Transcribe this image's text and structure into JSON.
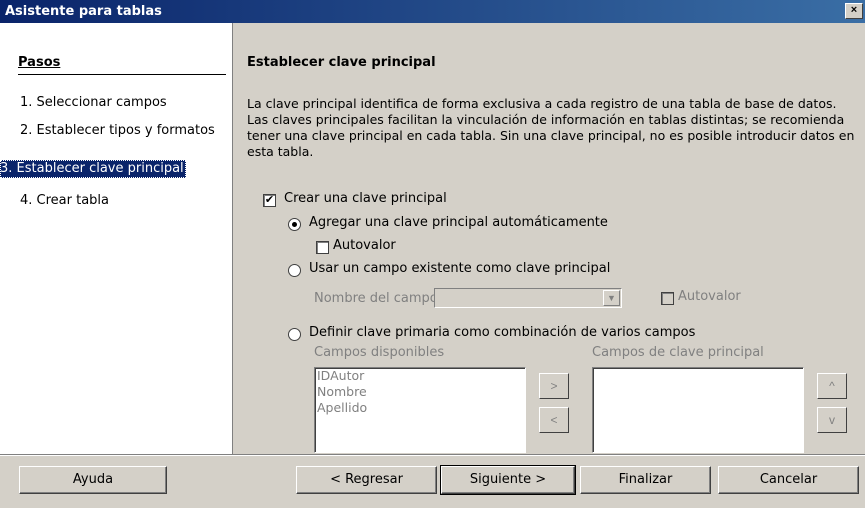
{
  "window": {
    "title": "Asistente para tablas",
    "close_glyph": "×"
  },
  "steps": {
    "header": "Pasos",
    "items": [
      "1.  Seleccionar campos",
      "2.  Establecer tipos y formatos",
      "3.  Establecer clave principal",
      "4.  Crear tabla"
    ],
    "selected_index": 2
  },
  "page": {
    "title": "Establecer clave principal",
    "description": "La clave principal identifica de forma exclusiva a cada registro de una tabla de base de datos. Las claves principales facilitan la vinculación de información en tablas distintas; se recomienda tener una clave principal en cada tabla. Sin una clave principal, no es posible introducir datos en esta tabla."
  },
  "options": {
    "create_pk": {
      "label": "Crear una clave principal",
      "checked": true
    },
    "auto_add": {
      "label": "Agregar una clave principal automáticamente",
      "checked": true
    },
    "autovalue1": {
      "label": "Autovalor",
      "checked": false
    },
    "use_existing": {
      "label": "Usar un campo existente como clave principal",
      "checked": false
    },
    "field_name_label": "Nombre del campo",
    "field_name_value": "",
    "autovalue2": {
      "label": "Autovalor",
      "checked": false
    },
    "define_combo": {
      "label": "Definir clave primaria como combinación de varios campos",
      "checked": false
    },
    "available_label": "Campos disponibles",
    "available_fields": [
      "IDAutor",
      "Nombre",
      "Apellido"
    ],
    "pk_fields_label": "Campos de clave principal",
    "pk_fields": [],
    "move_right": ">",
    "move_left": "<",
    "move_up": "^",
    "move_down": "v"
  },
  "buttons": {
    "help": "Ayuda",
    "back": "< Regresar",
    "next": "Siguiente >",
    "finish": "Finalizar",
    "cancel": "Cancelar"
  }
}
